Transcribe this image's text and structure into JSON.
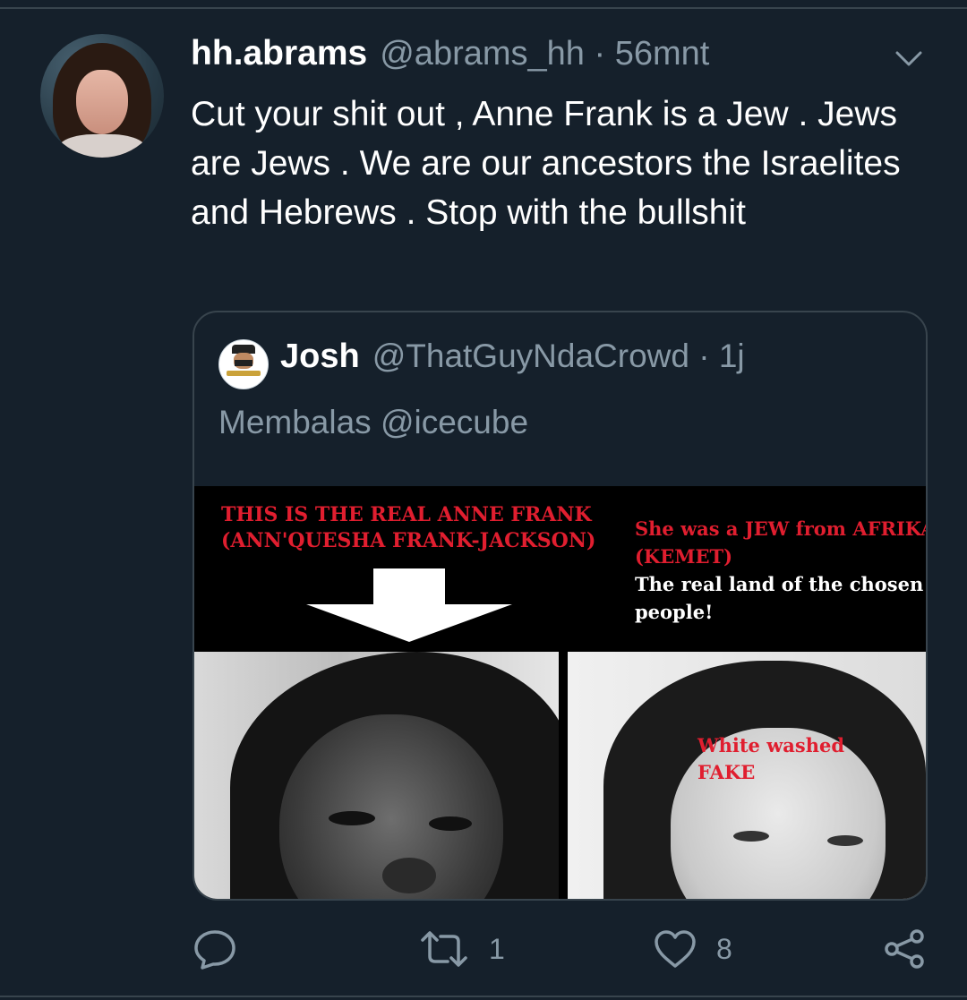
{
  "tweet": {
    "display_name": "hh.abrams",
    "handle_time": "@abrams_hh · 56mnt",
    "text": "Cut your shit out , Anne Frank is a Jew . Jews are Jews . We are our ancestors the Israelites and Hebrews . Stop with the bullshit"
  },
  "quoted": {
    "display_name": "Josh",
    "handle_time": "@ThatGuyNdaCrowd · 1j",
    "text": "Membalas @icecube",
    "image": {
      "top_left_line1": "THIS IS THE REAL ANNE FRANK",
      "top_left_line2": "(ANN'QUESHA FRANK-JACKSON)",
      "top_right_line1": "She was a JEW from AFRIKA",
      "top_right_line2": "(KEMET)",
      "top_right_line3": "The real land of the chosen",
      "top_right_line4": "people!",
      "overlay_line1": "White washed",
      "overlay_line2": "FAKE"
    }
  },
  "actions": {
    "reply_icon": "reply-icon",
    "retweet_icon": "retweet-icon",
    "retweet_count": "1",
    "like_icon": "heart-icon",
    "like_count": "8",
    "share_icon": "share-icon"
  },
  "colors": {
    "background": "#15202b",
    "muted_text": "#8899a6",
    "border": "#38444d",
    "meme_red": "#e01e2f"
  }
}
